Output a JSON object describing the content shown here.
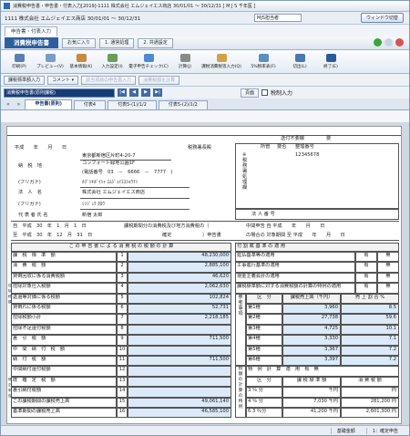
{
  "window": {
    "title": "消費税申告書・申告書・付表入力[2019]-1111 株式会社 エムジェイエス商店 30/01/01 ～ 30/12/31 [ M J S 千年医 ]"
  },
  "menubar": {
    "company": "1111 株式会社 エムジェイエス商店 30/01/01 ～ 30/12/31",
    "mus": "MJS担当者",
    "window_switch": "ウィンドウ切替"
  },
  "subtab": {
    "label": "申告書・付表入力"
  },
  "pagebar": {
    "title": "消費税申告書",
    "favorites": "お気に入り",
    "normal": "1. 通常処理",
    "shared": "2. 共通設定"
  },
  "toolbar": {
    "items": [
      "印刷(P)",
      "プレビュー(V)",
      "基本情報(K)",
      "入力設定(I)",
      "電子申告チェック(C)",
      "計算(J)",
      "課税消費税等入力(Q)",
      "5%税率表(F)",
      "切出(L)",
      "終了(E)"
    ]
  },
  "toolbar2": {
    "items": [
      "課税標準額入力",
      "コメント ▾",
      "該当項目の申告書入力",
      "消費税額を計算"
    ]
  },
  "navrow": {
    "select": "消費税申告書(原則課税)",
    "first": "|◀",
    "prev": "◀",
    "next": "▶",
    "last": "▶|",
    "pages": "頁面",
    "tax_adjust": "税制入力"
  },
  "tabs": [
    "申告書(原則)",
    "付表4",
    "付表5-(1)/1/2",
    "付表5-(2)/1/2"
  ],
  "header": {
    "date_label": "平成　　年　　月　　日",
    "office": "税務署長殿",
    "address_label": "納　税　地",
    "address": "東京都新宿区片町4-20-7",
    "address2": "コンフォート緑地公園1F",
    "phone": "(電話番号　03　－　6666　－　7777　)",
    "furigana_label": "(フリガナ)",
    "furigana": "ｶﾌﾞｼｷｶﾞｲｼｬ ｴﾑｼﾞｪｲｴｽｼｮｳﾃﾝ",
    "corp_label": "法　人　名",
    "corp": "株式会社 エムジェイエス商店",
    "furigana2": "ｼﾝｼﾞｭｸ ﾀﾛｳ",
    "rep_label": "代 表 者 氏 名",
    "rep": "新宿 太郎",
    "corpno_label": "法 人 番 号",
    "send_label": "送付不要欄",
    "send_val": "要",
    "office_label": "所管",
    "req_label": "要否",
    "seiri_label": "整理番号",
    "seiri": "12345678",
    "side_label": "※税務署処理欄"
  },
  "period": {
    "from_label": "自　平成　30　年　1　月　1　日",
    "to_label": "至　平成　30　年　12　月　31　日",
    "kind_label": "課税期間分の消費税及び地方消費税の（",
    "kind": "確定",
    "kind2": "）申告書",
    "mid_label": "中間申告 自 平成　　年　　月　　日",
    "mid2": "の場合の 対象期間 至 平成　　年　　月　　日"
  },
  "calc": {
    "header": "こ の 申 告 書 に よ る 消 費 税 の 税 額 の 計 算",
    "rows": [
      {
        "label": "課　税　標　準　額",
        "no": "1",
        "value": "48,230,000"
      },
      {
        "label": "消　費　税　額",
        "no": "2",
        "value": "2,885,100"
      },
      {
        "label": "貸倒回収に係る消費税額",
        "no": "3",
        "value": "46,620"
      },
      {
        "label": "控除対象仕入税額",
        "no": "4",
        "value": "2,062,630"
      },
      {
        "label": "返還等対価に係る税額",
        "no": "5",
        "value": "102,824"
      },
      {
        "label": "貸倒れに係る税額",
        "no": "6",
        "value": "52,731"
      },
      {
        "label": "控除税額小計",
        "no": "7",
        "value": "2,218,185"
      },
      {
        "label": "控除不足還付税額",
        "no": "8",
        "value": ""
      },
      {
        "label": "差　引　税　額",
        "no": "9",
        "value": "711,500"
      },
      {
        "label": "中　間　納　付　税　額",
        "no": "10",
        "value": ""
      },
      {
        "label": "納　付　税　額",
        "no": "11",
        "value": "711,500"
      },
      {
        "label": "中間納付還付税額",
        "no": "12",
        "value": ""
      },
      {
        "label": "既　確　定　税　額",
        "no": "13",
        "value": ""
      },
      {
        "label": "差引納付税額",
        "no": "14",
        "value": ""
      },
      {
        "label": "この課税期間の課税売上高",
        "no": "15",
        "value": "49,061,140"
      },
      {
        "label": "基準期間の課税売上高",
        "no": "16",
        "value": "46,585,100"
      }
    ],
    "side_labels": [
      "控除税額",
      "修正申告"
    ]
  },
  "right": {
    "header": "付 割 賦 基 準 の 適 用",
    "rows": [
      "延払基準等の適用",
      "工事進行基準の適用",
      "現金主義会計の適用",
      "課税標準額に対する消費税額の計算の特例の適用"
    ],
    "yes": "有",
    "no": "無",
    "biz_header": [
      "区　分",
      "課税売上高（千円）",
      "売 上 割 合 %"
    ],
    "biz_rows": [
      {
        "k": "第1種",
        "v": "3,960",
        "r": "8.5"
      },
      {
        "k": "第2種",
        "v": "27,738",
        "r": "59.6"
      },
      {
        "k": "第3種",
        "v": "4,725",
        "r": "10.1"
      },
      {
        "k": "第4種",
        "v": "3,330",
        "r": "7.1"
      },
      {
        "k": "第5種",
        "v": "3,367",
        "r": "7.2"
      },
      {
        "k": "第6種",
        "v": "3,397",
        "r": "7.2"
      }
    ],
    "tokurei": "特　例　計　算　適　用　有　無",
    "rate_header": [
      "区　分",
      "課 税 標 準 額",
      "消 費 税 額"
    ],
    "rates": [
      {
        "k": "3 ％ 分",
        "v": "千円",
        "t": "円"
      },
      {
        "k": "4 ％ 分",
        "v": "7,030 千円",
        "t": "281,200 円"
      },
      {
        "k": "6.3 ％分",
        "v": "41,200 千円",
        "t": "2,601,300 円"
      }
    ],
    "side": [
      "参考事項",
      "税額の計算の特例",
      "区分"
    ]
  },
  "status": {
    "a": "基礎金額",
    "b": "1：確定申告"
  }
}
